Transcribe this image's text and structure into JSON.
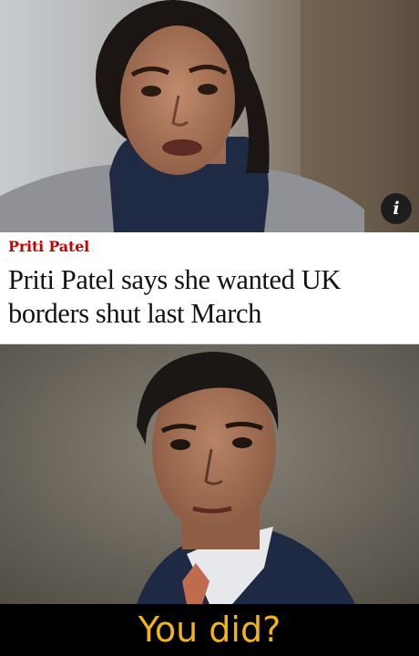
{
  "top_photo": {
    "icon": "photo-icon"
  },
  "info_button": {
    "label": "i",
    "icon": "info-icon"
  },
  "article": {
    "kicker": "Priti Patel",
    "headline": "Priti Patel says she wanted UK borders shut last March",
    "kicker_color": "#c70000"
  },
  "bottom_photo": {
    "icon": "photo-icon"
  },
  "caption": {
    "text": "You did?",
    "color": "#f0b416"
  }
}
